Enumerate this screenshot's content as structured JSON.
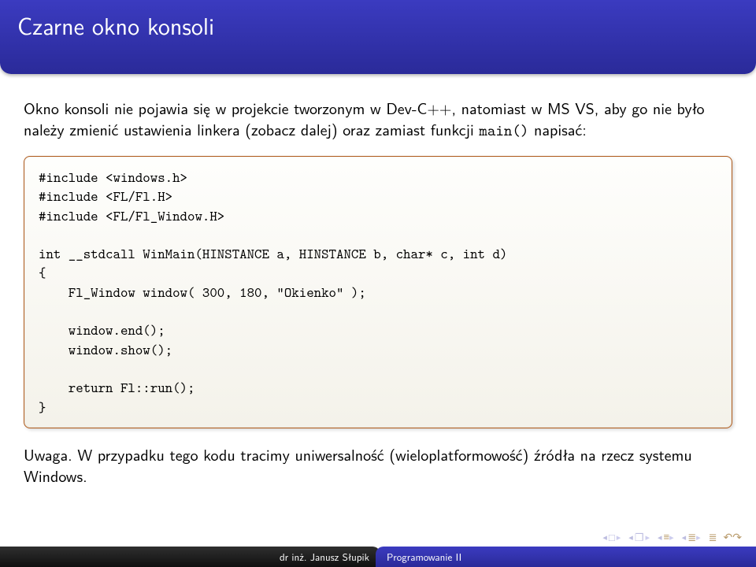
{
  "title": "Czarne okno konsoli",
  "intro_a": "Okno konsoli nie pojawia się w projekcie tworzonym w Dev-C++, natomiast w MS VS, aby go nie było należy zmienić ustawienia linkera (zobacz dalej) oraz zamiast funkcji ",
  "intro_code": "main()",
  "intro_b": " napisać:",
  "code": "#include <windows.h>\n#include <FL/Fl.H>\n#include <FL/Fl_Window.H>\n\nint __stdcall WinMain(HINSTANCE a, HINSTANCE b, char* c, int d)\n{\n    Fl_Window window( 300, 180, \"Okienko\" );\n\n    window.end();\n    window.show();\n\n    return Fl::run();\n}",
  "note": "Uwaga. W przypadku tego kodu tracimy uniwersalność (wieloplatformowość) źródła na rzecz systemu Windows.",
  "footer": {
    "author": "dr inż. Janusz Słupik",
    "course": "Programowanie II"
  }
}
